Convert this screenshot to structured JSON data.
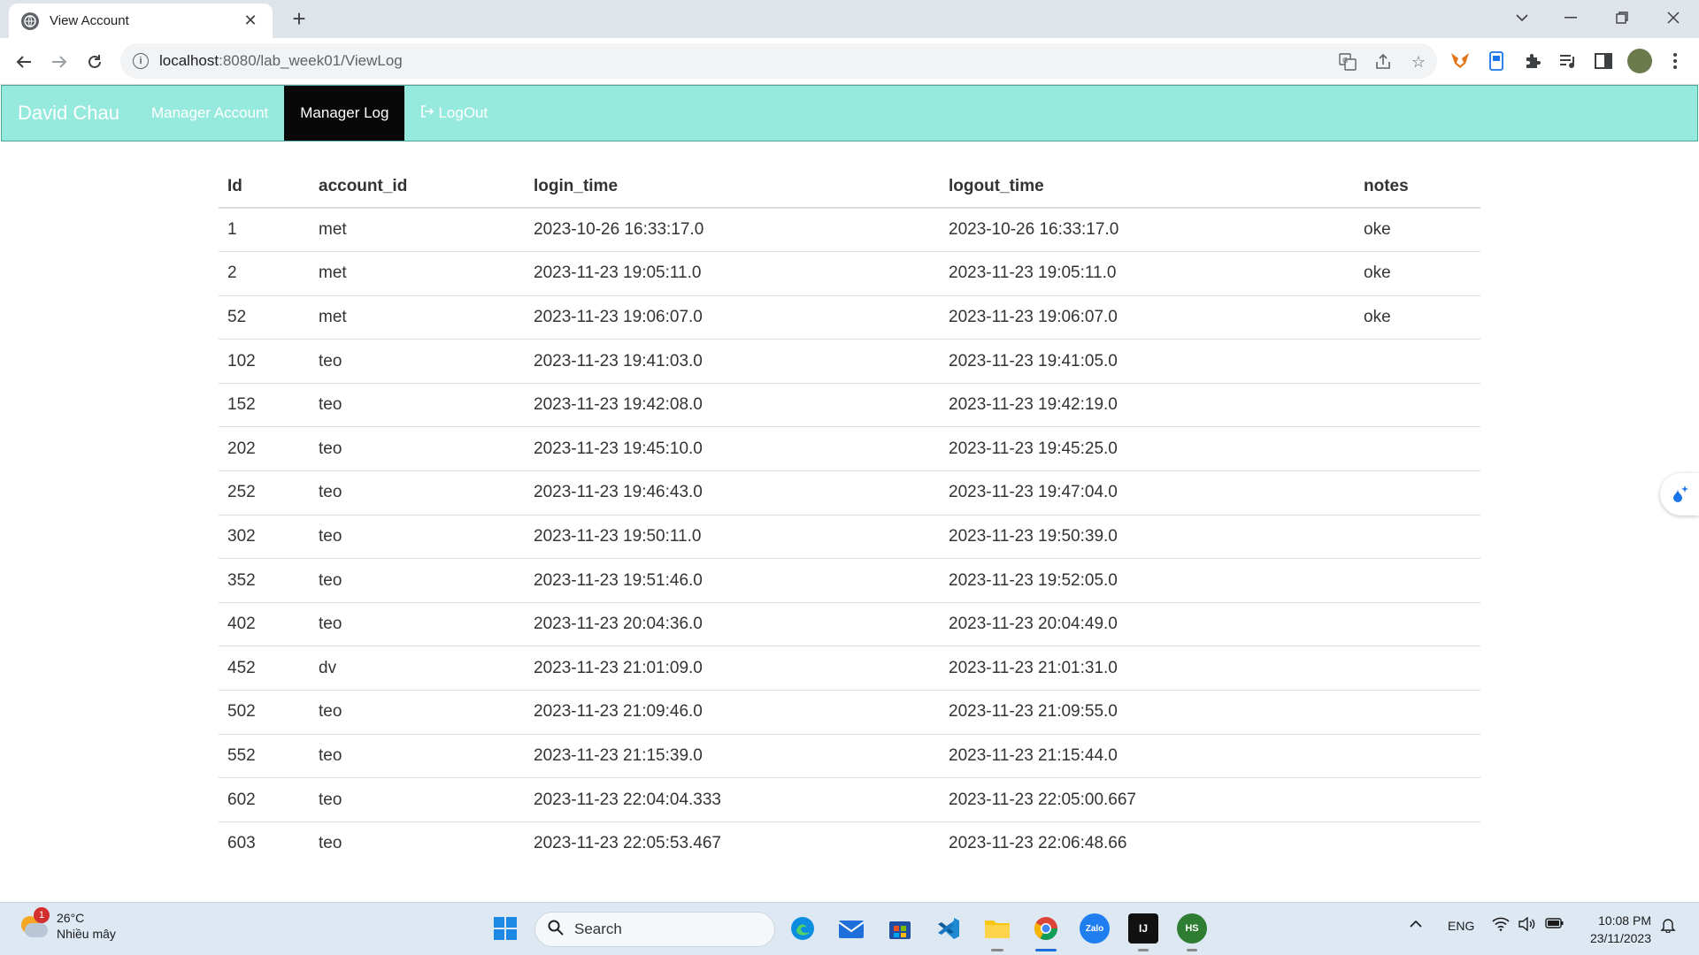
{
  "browser": {
    "tab_title": "View Account",
    "url_host": "localhost",
    "url_rest": ":8080/lab_week01/ViewLog"
  },
  "navbar": {
    "brand": "David Chau",
    "items": [
      {
        "label": "Manager Account",
        "active": false
      },
      {
        "label": "Manager Log",
        "active": true
      },
      {
        "label": "LogOut",
        "active": false
      }
    ]
  },
  "table": {
    "headers": [
      "Id",
      "account_id",
      "login_time",
      "logout_time",
      "notes"
    ],
    "rows": [
      [
        "1",
        "met",
        "2023-10-26 16:33:17.0",
        "2023-10-26 16:33:17.0",
        "oke"
      ],
      [
        "2",
        "met",
        "2023-11-23 19:05:11.0",
        "2023-11-23 19:05:11.0",
        "oke"
      ],
      [
        "52",
        "met",
        "2023-11-23 19:06:07.0",
        "2023-11-23 19:06:07.0",
        "oke"
      ],
      [
        "102",
        "teo",
        "2023-11-23 19:41:03.0",
        "2023-11-23 19:41:05.0",
        ""
      ],
      [
        "152",
        "teo",
        "2023-11-23 19:42:08.0",
        "2023-11-23 19:42:19.0",
        ""
      ],
      [
        "202",
        "teo",
        "2023-11-23 19:45:10.0",
        "2023-11-23 19:45:25.0",
        ""
      ],
      [
        "252",
        "teo",
        "2023-11-23 19:46:43.0",
        "2023-11-23 19:47:04.0",
        ""
      ],
      [
        "302",
        "teo",
        "2023-11-23 19:50:11.0",
        "2023-11-23 19:50:39.0",
        ""
      ],
      [
        "352",
        "teo",
        "2023-11-23 19:51:46.0",
        "2023-11-23 19:52:05.0",
        ""
      ],
      [
        "402",
        "teo",
        "2023-11-23 20:04:36.0",
        "2023-11-23 20:04:49.0",
        ""
      ],
      [
        "452",
        "dv",
        "2023-11-23 21:01:09.0",
        "2023-11-23 21:01:31.0",
        ""
      ],
      [
        "502",
        "teo",
        "2023-11-23 21:09:46.0",
        "2023-11-23 21:09:55.0",
        ""
      ],
      [
        "552",
        "teo",
        "2023-11-23 21:15:39.0",
        "2023-11-23 21:15:44.0",
        ""
      ],
      [
        "602",
        "teo",
        "2023-11-23 22:04:04.333",
        "2023-11-23 22:05:00.667",
        ""
      ],
      [
        "603",
        "teo",
        "2023-11-23 22:05:53.467",
        "2023-11-23 22:06:48.66",
        ""
      ]
    ]
  },
  "taskbar": {
    "weather_temp": "26°C",
    "weather_cond": "Nhiều mây",
    "weather_badge": "1",
    "search_placeholder": "Search",
    "lang": "ENG",
    "time": "10:08 PM",
    "date": "23/11/2023",
    "zalo_label": "Zalo",
    "hs_label": "HS",
    "ij_label": "IJ"
  },
  "colors": {
    "navbar_bg": "#96e9dd",
    "navbar_active": "#080808"
  }
}
